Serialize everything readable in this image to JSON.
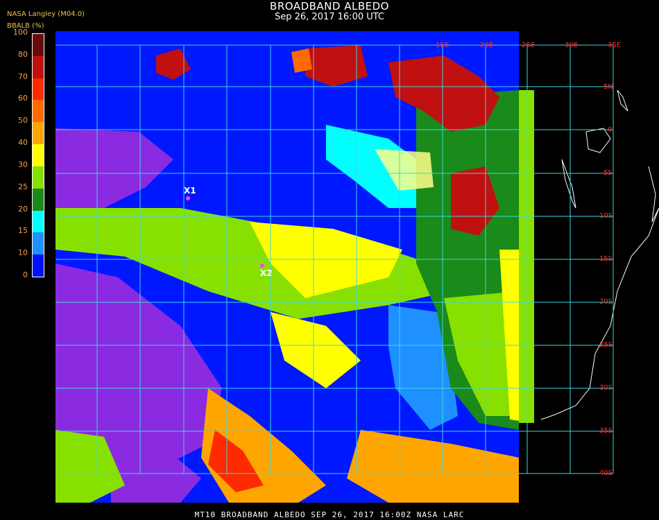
{
  "header": {
    "title": "BROADBAND ALBEDO",
    "subtitle": "Sep 26, 2017 16:00 UTC",
    "org": "NASA Langley (M04.0)",
    "colorbar_label": "BBALB (%)"
  },
  "colorbar": {
    "ticks": [
      "100",
      "80",
      "70",
      "60",
      "50",
      "40",
      "30",
      "25",
      "20",
      "15",
      "10",
      "0"
    ],
    "colors": [
      "#6a0a0a",
      "#c01010",
      "#ff2a00",
      "#ff6a00",
      "#ffa500",
      "#ffff00",
      "#88e000",
      "#1a8a1a",
      "#00ffff",
      "#1e90ff",
      "#0010ff",
      "#8a2be2"
    ]
  },
  "grid": {
    "lon_labels": [
      "15E",
      "20E",
      "25E",
      "30E",
      "35E"
    ],
    "lat_labels": [
      "5N",
      "0",
      "5S",
      "10S",
      "15S",
      "20S",
      "25S",
      "30S",
      "35S",
      "40S"
    ],
    "line_color": "#3cd8e0",
    "label_color": "#ff3030"
  },
  "markers": [
    {
      "label": "X1"
    },
    {
      "label": "X2"
    }
  ],
  "footer": "MT10   BROADBAND ALBEDO   SEP 26, 2017 16:00Z   NASA LARC"
}
